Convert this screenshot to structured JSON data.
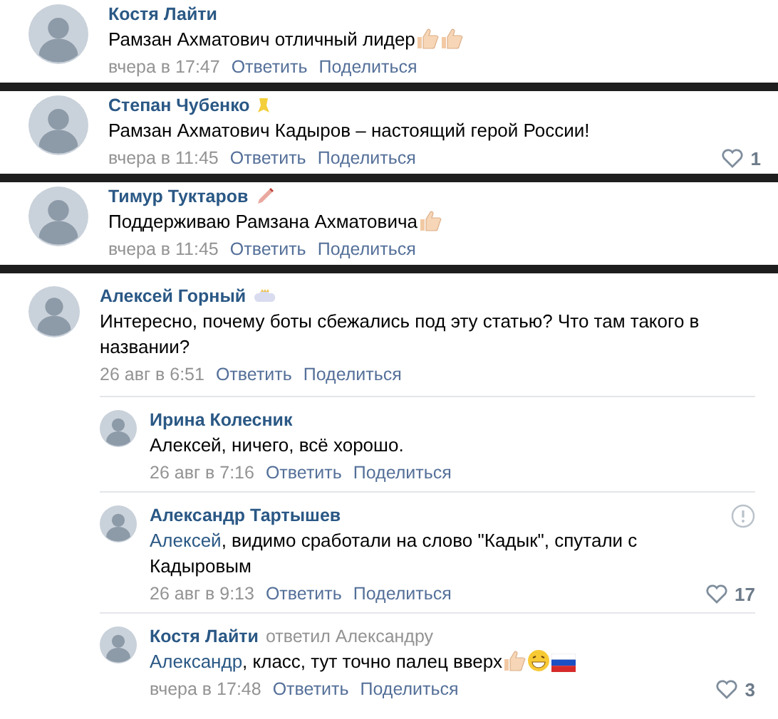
{
  "strips": [
    {
      "comments": [
        {
          "author": "Костя Лайти",
          "text": "Рамзан Ахматович отличный лидер",
          "emoji": [
            {
              "kind": "thumbs-up"
            },
            {
              "kind": "thumbs-up"
            }
          ],
          "date": "вчера в 17:47",
          "reply": "Ответить",
          "share": "Поделиться"
        }
      ]
    },
    {
      "comments": [
        {
          "author": "Степан Чубенко",
          "badge": {
            "kind": "ribbon"
          },
          "text": "Рамзан Ахматович Кадыров – настоящий герой России!",
          "date": "вчера в 11:45",
          "reply": "Ответить",
          "share": "Поделиться",
          "likes": "1"
        }
      ]
    },
    {
      "comments": [
        {
          "author": "Тимур Туктаров",
          "badge": {
            "kind": "pen"
          },
          "text": "Поддерживаю Рамзана Ахматовича",
          "emoji": [
            {
              "kind": "thumbs-up"
            }
          ],
          "date": "вчера в 11:45",
          "reply": "Ответить",
          "share": "Поделиться"
        }
      ]
    }
  ],
  "thread": {
    "author": "Алексей Горный",
    "badge": {
      "kind": "cloud"
    },
    "text": "Интересно, почему боты сбежались под эту статью? Что там такого в названии?",
    "date": "26 авг в 6:51",
    "reply": "Ответить",
    "share": "Поделиться",
    "replies": [
      {
        "author": "Ирина Колесник",
        "text": "Алексей, ничего, всё хорошо.",
        "date": "26 авг в 7:16",
        "reply": "Ответить",
        "share": "Поделиться",
        "report_icon": false
      },
      {
        "author": "Александр Тартышев",
        "mention": "Алексей",
        "text": ", видимо сработали на слово \"Кадык\", спутали с Кадыровым",
        "date": "26 авг в 9:13",
        "reply": "Ответить",
        "share": "Поделиться",
        "likes": "17",
        "report_icon": true
      },
      {
        "author": "Костя Лайти",
        "replied_to": "ответил Александру",
        "mention": "Александр",
        "text": ", класс, тут точно палец вверх",
        "emoji": [
          {
            "kind": "thumbs-up"
          },
          {
            "kind": "grin"
          },
          {
            "kind": "flag-russia"
          }
        ],
        "date": "вчера в 17:48",
        "reply": "Ответить",
        "share": "Поделиться",
        "likes": "3",
        "report_icon": false
      }
    ]
  }
}
